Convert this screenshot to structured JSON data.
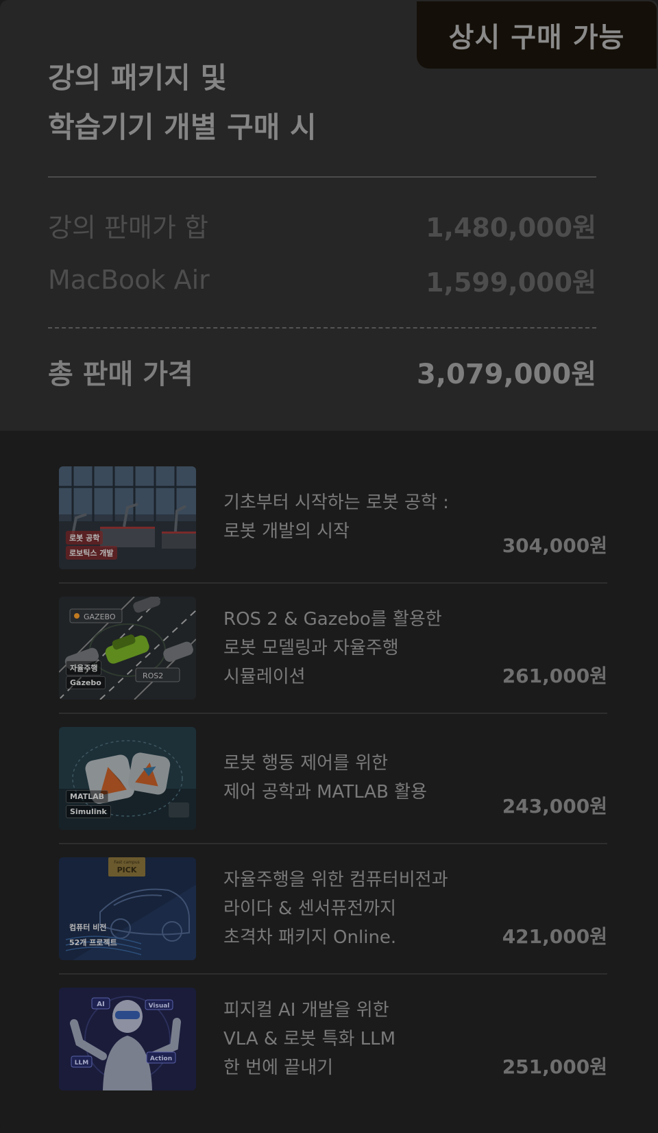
{
  "badge": "상시 구매 가능",
  "heading": {
    "line1": "강의 패키지 및",
    "line2": "학습기기 개별 구매 시"
  },
  "rows": [
    {
      "label": "강의 판매가 합",
      "value": "1,480,000원"
    },
    {
      "label": "MacBook Air",
      "value": "1,599,000원"
    }
  ],
  "total": {
    "label": "총 판매 가격",
    "value": "3,079,000원"
  },
  "courses": [
    {
      "title_lines": [
        "기초부터 시작하는 로봇 공학 :",
        "로봇 개발의 시작"
      ],
      "price": "304,000원",
      "tags": [
        "로봇 공학",
        "로보틱스 개발"
      ]
    },
    {
      "title_lines": [
        "ROS 2 & Gazebo를 활용한",
        "로봇 모델링과 자율주행",
        "시뮬레이션"
      ],
      "price": "261,000원",
      "tags": [
        "자율주행",
        "Gazebo"
      ],
      "logos": [
        "GAZEBO",
        "ROS2"
      ]
    },
    {
      "title_lines": [
        "로봇 행동 제어를 위한",
        "제어 공학과 MATLAB 활용"
      ],
      "price": "243,000원",
      "tags": [
        "MATLAB",
        "Simulink"
      ]
    },
    {
      "title_lines": [
        "자율주행을 위한 컴퓨터비전과",
        "라이다 & 센서퓨전까지",
        "초격차 패키지 Online."
      ],
      "price": "421,000원",
      "tags": [
        "컴퓨터 비전",
        "52개 프로젝트"
      ],
      "pick": {
        "top": "Fast campus",
        "label": "PICK"
      }
    },
    {
      "title_lines": [
        "피지컬 AI 개발을 위한",
        "VLA & 로봇 특화 LLM",
        "한 번에 끝내기"
      ],
      "price": "251,000원",
      "tags": [
        "AI",
        "Visual",
        "LLM",
        "Action"
      ]
    }
  ]
}
